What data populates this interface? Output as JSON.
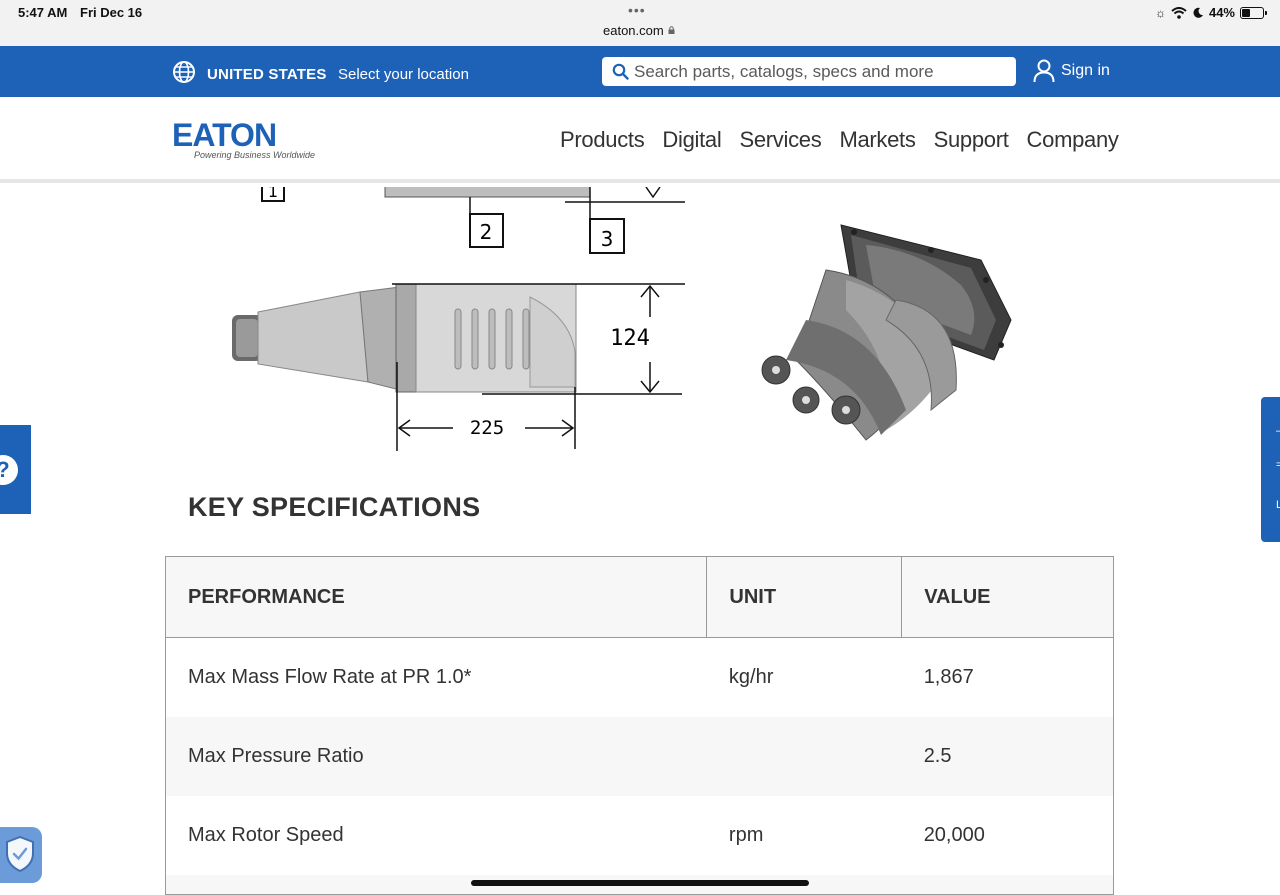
{
  "status_bar": {
    "time": "5:47 AM",
    "date": "Fri Dec 16",
    "url": "eaton.com",
    "battery": "44%",
    "battery_level": 0.44
  },
  "utility_bar": {
    "country": "UNITED STATES",
    "location_link": "Select your location",
    "search_placeholder": "Search parts, catalogs, specs and more",
    "sign_in": "Sign in"
  },
  "header": {
    "logo_text": "EATON",
    "logo_tagline": "Powering Business Worldwide",
    "nav": [
      "Products",
      "Digital",
      "Services",
      "Markets",
      "Support",
      "Company"
    ]
  },
  "drawing": {
    "callouts": [
      "1",
      "2",
      "3"
    ],
    "height_label": "124",
    "length_label": "225"
  },
  "specs": {
    "title": "KEY SPECIFICATIONS",
    "headers": [
      "PERFORMANCE",
      "UNIT",
      "VALUE"
    ],
    "rows": [
      {
        "performance": "Max Mass Flow Rate at PR 1.0*",
        "unit": "kg/hr",
        "value": "1,867"
      },
      {
        "performance": "Max Pressure Ratio",
        "unit": "",
        "value": "2.5"
      },
      {
        "performance": "Max Rotor Speed",
        "unit": "rpm",
        "value": "20,000"
      }
    ]
  },
  "widgets": {
    "help_glyph": "?"
  },
  "colors": {
    "brand_blue": "#1e62b8",
    "text": "#333333",
    "table_alt_row": "#f7f7f7"
  }
}
